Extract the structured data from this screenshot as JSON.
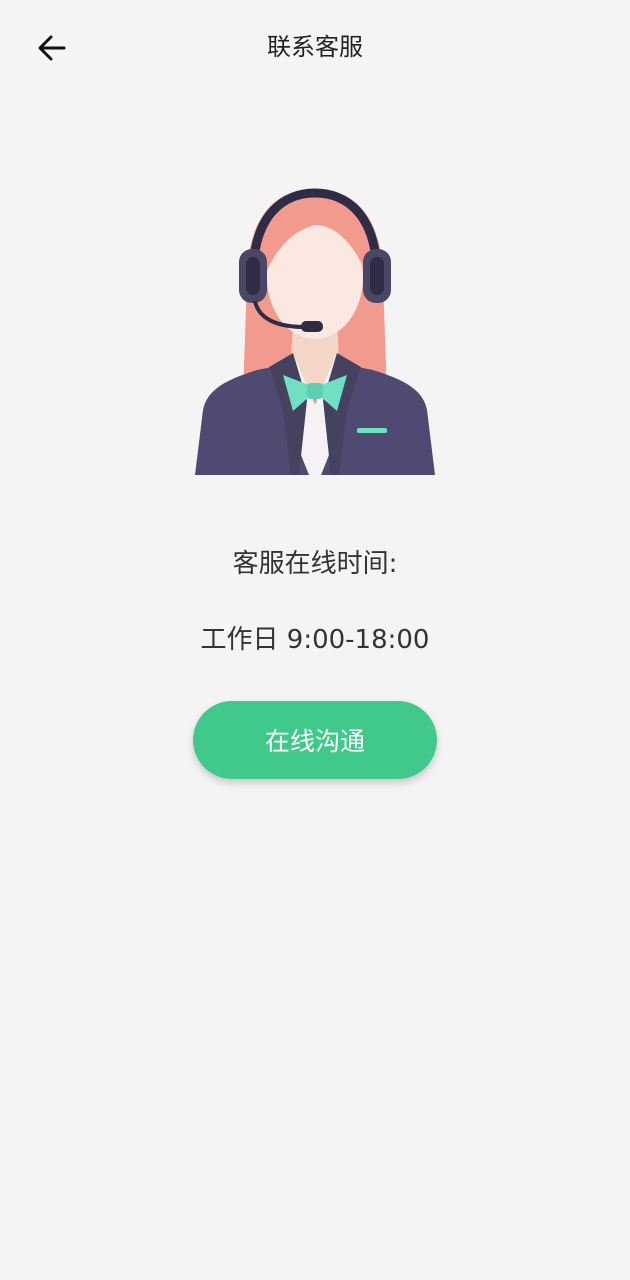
{
  "header": {
    "title": "联系客服",
    "back_icon": "arrow-left-icon"
  },
  "illustration": {
    "icon": "customer-service-agent-illustration",
    "colors": {
      "hair": "#f29a8e",
      "skin": "#fbe9e1",
      "headset": "#3f3d5c",
      "suit": "#4e4a72",
      "bowtie": "#6fe0c2"
    }
  },
  "content": {
    "online_time_label": "客服在线时间:",
    "hours": "工作日 9:00-18:00"
  },
  "action": {
    "chat_label": "在线沟通",
    "accent_color": "#41c98b"
  }
}
